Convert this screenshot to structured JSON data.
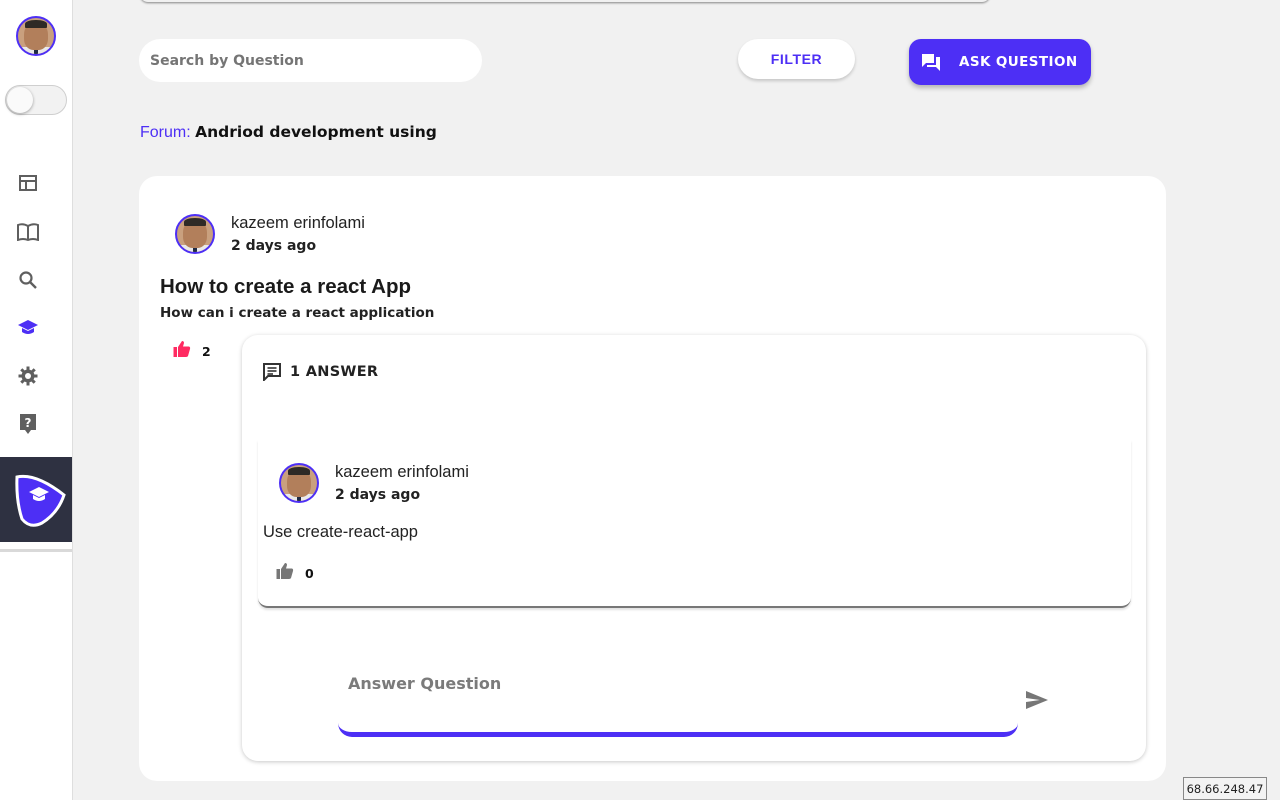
{
  "search": {
    "placeholder": "Search by Question"
  },
  "toolbar": {
    "filter_label": "FILTER",
    "ask_label": "ASK QUESTION",
    "ask_icon": "forum-icon"
  },
  "breadcrumb": {
    "label": "Forum:",
    "forum_name": "Andriod development using"
  },
  "sidebar": {
    "icons": [
      "dashboard-icon",
      "book-icon",
      "search-icon",
      "school-icon",
      "settings-icon",
      "help-icon"
    ],
    "active_icon": "school-icon",
    "brand_icon": "logo-icon"
  },
  "question": {
    "author": "kazeem erinfolami",
    "time": "2 days ago",
    "title": "How to create a react App",
    "body": "How can i create a react application",
    "likes": "2"
  },
  "answers": {
    "header": "1 ANSWER",
    "items": [
      {
        "author": "kazeem erinfolami",
        "time": "2 days ago",
        "text": "Use create-react-app",
        "likes": "0"
      }
    ]
  },
  "answer_input": {
    "placeholder": "Answer Question"
  },
  "ip_address": "68.66.248.47",
  "colors": {
    "accent": "#4d2ff5",
    "like_active": "#ff2b62",
    "sidebar_dark": "#2e3141",
    "background": "#f1f1f1"
  }
}
